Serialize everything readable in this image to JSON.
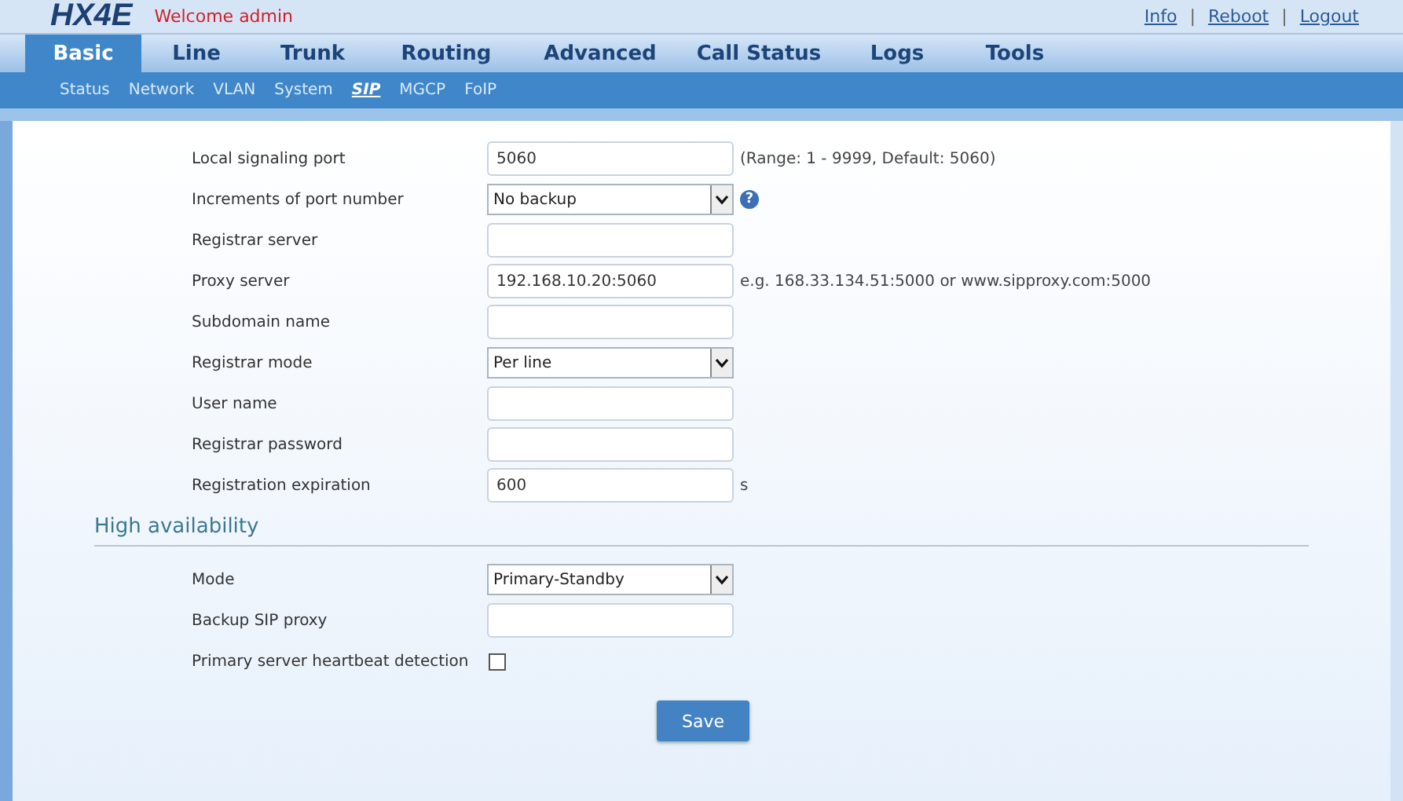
{
  "header": {
    "logo": "HX4E",
    "welcome": "Welcome admin",
    "links": [
      "Info",
      "Reboot",
      "Logout"
    ],
    "separators": [
      "|",
      "|"
    ]
  },
  "tabs": [
    {
      "label": "Basic",
      "selected": true
    },
    {
      "label": "Line",
      "selected": false
    },
    {
      "label": "Trunk",
      "selected": false
    },
    {
      "label": "Routing",
      "selected": false
    },
    {
      "label": "Advanced",
      "selected": false
    },
    {
      "label": "Call Status",
      "selected": false
    },
    {
      "label": "Logs",
      "selected": false
    },
    {
      "label": "Tools",
      "selected": false
    }
  ],
  "subtabs": [
    {
      "label": "Status",
      "selected": false
    },
    {
      "label": "Network",
      "selected": false
    },
    {
      "label": "VLAN",
      "selected": false
    },
    {
      "label": "System",
      "selected": false
    },
    {
      "label": "SIP",
      "selected": true
    },
    {
      "label": "MGCP",
      "selected": false
    },
    {
      "label": "FoIP",
      "selected": false
    }
  ],
  "sections": [
    {
      "fields": [
        {
          "kind": "text",
          "label": "Local signaling port",
          "value": "5060",
          "note": "(Range: 1 - 9999, Default: 5060)"
        },
        {
          "kind": "select",
          "label": "Increments of port number",
          "value": "No backup",
          "help": "?"
        },
        {
          "kind": "text",
          "label": "Registrar server"
        },
        {
          "kind": "text",
          "label": "Proxy server",
          "value": "192.168.10.20:5060",
          "note": "e.g. 168.33.134.51:5000 or www.sipproxy.com:5000"
        },
        {
          "kind": "text",
          "label": "Subdomain name"
        },
        {
          "kind": "select",
          "label": "Registrar mode",
          "value": "Per line"
        },
        {
          "kind": "text",
          "label": "User name"
        },
        {
          "kind": "text",
          "label": "Registrar password"
        },
        {
          "kind": "text",
          "label": "Registration expiration",
          "value": "600",
          "note": "s"
        }
      ]
    },
    {
      "title": "High availability",
      "fields": [
        {
          "kind": "select",
          "label": "Mode",
          "value": "Primary-Standby"
        },
        {
          "kind": "text",
          "label": "Backup SIP proxy"
        },
        {
          "kind": "checkbox",
          "label": "Primary server heartbeat detection",
          "checked": false
        }
      ]
    }
  ],
  "save_button": "Save"
}
